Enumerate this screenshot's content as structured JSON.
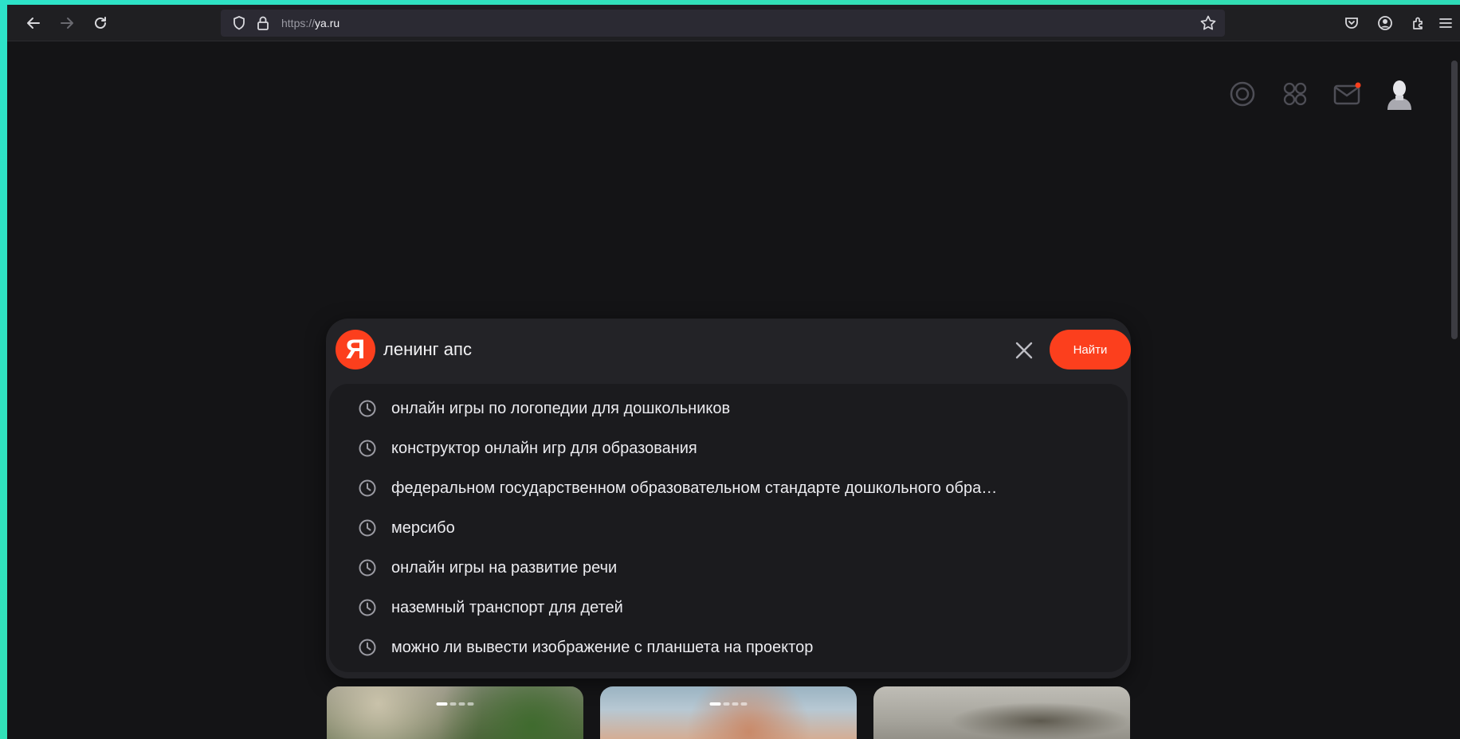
{
  "browser": {
    "url": {
      "scheme": "https://",
      "host": "ya.ru"
    }
  },
  "search": {
    "query": "ленинг апс",
    "logo_letter": "Я",
    "submit_label": "Найти",
    "suggestions": [
      "онлайн игры по логопедии для дошкольников",
      "конструктор онлайн игр для образования",
      "федеральном государственном образовательном стандарте дошкольного обра…",
      "мерсибо",
      "онлайн игры на развитие речи",
      "наземный транспорт для детей",
      "можно ли вывести изображение с планшета на проектор"
    ]
  },
  "header_icons": [
    "alice-icon",
    "services-grid-icon",
    "mail-icon",
    "avatar"
  ],
  "colors": {
    "accent": "#fc3f1d",
    "background": "#141416",
    "panel": "#232327"
  }
}
